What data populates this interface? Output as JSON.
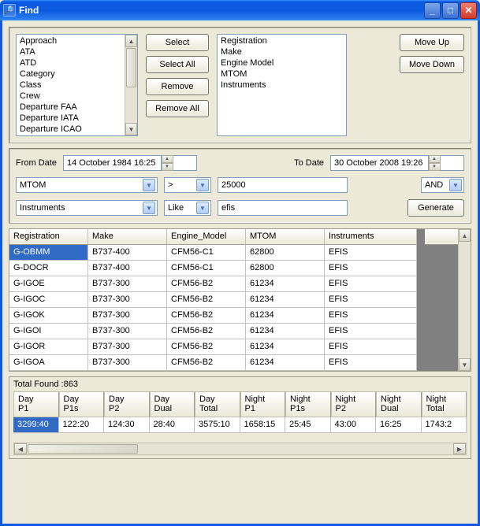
{
  "window": {
    "title": "Find"
  },
  "available_fields": [
    "Approach",
    "ATA",
    "ATD",
    "Category",
    "Class",
    "Crew",
    "Departure FAA",
    "Departure IATA",
    "Departure ICAO"
  ],
  "selected_fields": [
    "Registration",
    "Make",
    "Engine Model",
    "MTOM",
    "Instruments"
  ],
  "buttons": {
    "select": "Select",
    "select_all": "Select All",
    "remove": "Remove",
    "remove_all": "Remove All",
    "move_up": "Move Up",
    "move_down": "Move Down",
    "generate": "Generate"
  },
  "filter": {
    "from_label": "From Date",
    "from_value": "14   October   1984     16:25",
    "to_label": "To Date",
    "to_value": "30   October   2008     19:26",
    "row1": {
      "field": "MTOM",
      "op": ">",
      "value": "25000",
      "conj": "AND"
    },
    "row2": {
      "field": "Instruments",
      "op": "Like",
      "value": "efis"
    }
  },
  "results": {
    "columns": [
      "Registration",
      "Make",
      "Engine_Model",
      "MTOM",
      "Instruments"
    ],
    "rows": [
      [
        "G-OBMM",
        "B737-400",
        "CFM56-C1",
        "62800",
        "EFIS"
      ],
      [
        "G-DOCR",
        "B737-400",
        "CFM56-C1",
        "62800",
        "EFIS"
      ],
      [
        "G-IGOE",
        "B737-300",
        "CFM56-B2",
        "61234",
        "EFIS"
      ],
      [
        "G-IGOC",
        "B737-300",
        "CFM56-B2",
        "61234",
        "EFIS"
      ],
      [
        "G-IGOK",
        "B737-300",
        "CFM56-B2",
        "61234",
        "EFIS"
      ],
      [
        "G-IGOI",
        "B737-300",
        "CFM56-B2",
        "61234",
        "EFIS"
      ],
      [
        "G-IGOR",
        "B737-300",
        "CFM56-B2",
        "61234",
        "EFIS"
      ],
      [
        "G-IGOA",
        "B737-300",
        "CFM56-B2",
        "61234",
        "EFIS"
      ]
    ],
    "total_label": "Total Found :863"
  },
  "summary": {
    "columns": [
      "Day P1",
      "Day P1s",
      "Day P2",
      "Day Dual",
      "Day Total",
      "Night P1",
      "Night P1s",
      "Night P2",
      "Night Dual",
      "Night Total"
    ],
    "values": [
      "3299:40",
      "122:20",
      "124:30",
      "28:40",
      "3575:10",
      "1658:15",
      "25:45",
      "43:00",
      "16:25",
      "1743:2"
    ]
  }
}
